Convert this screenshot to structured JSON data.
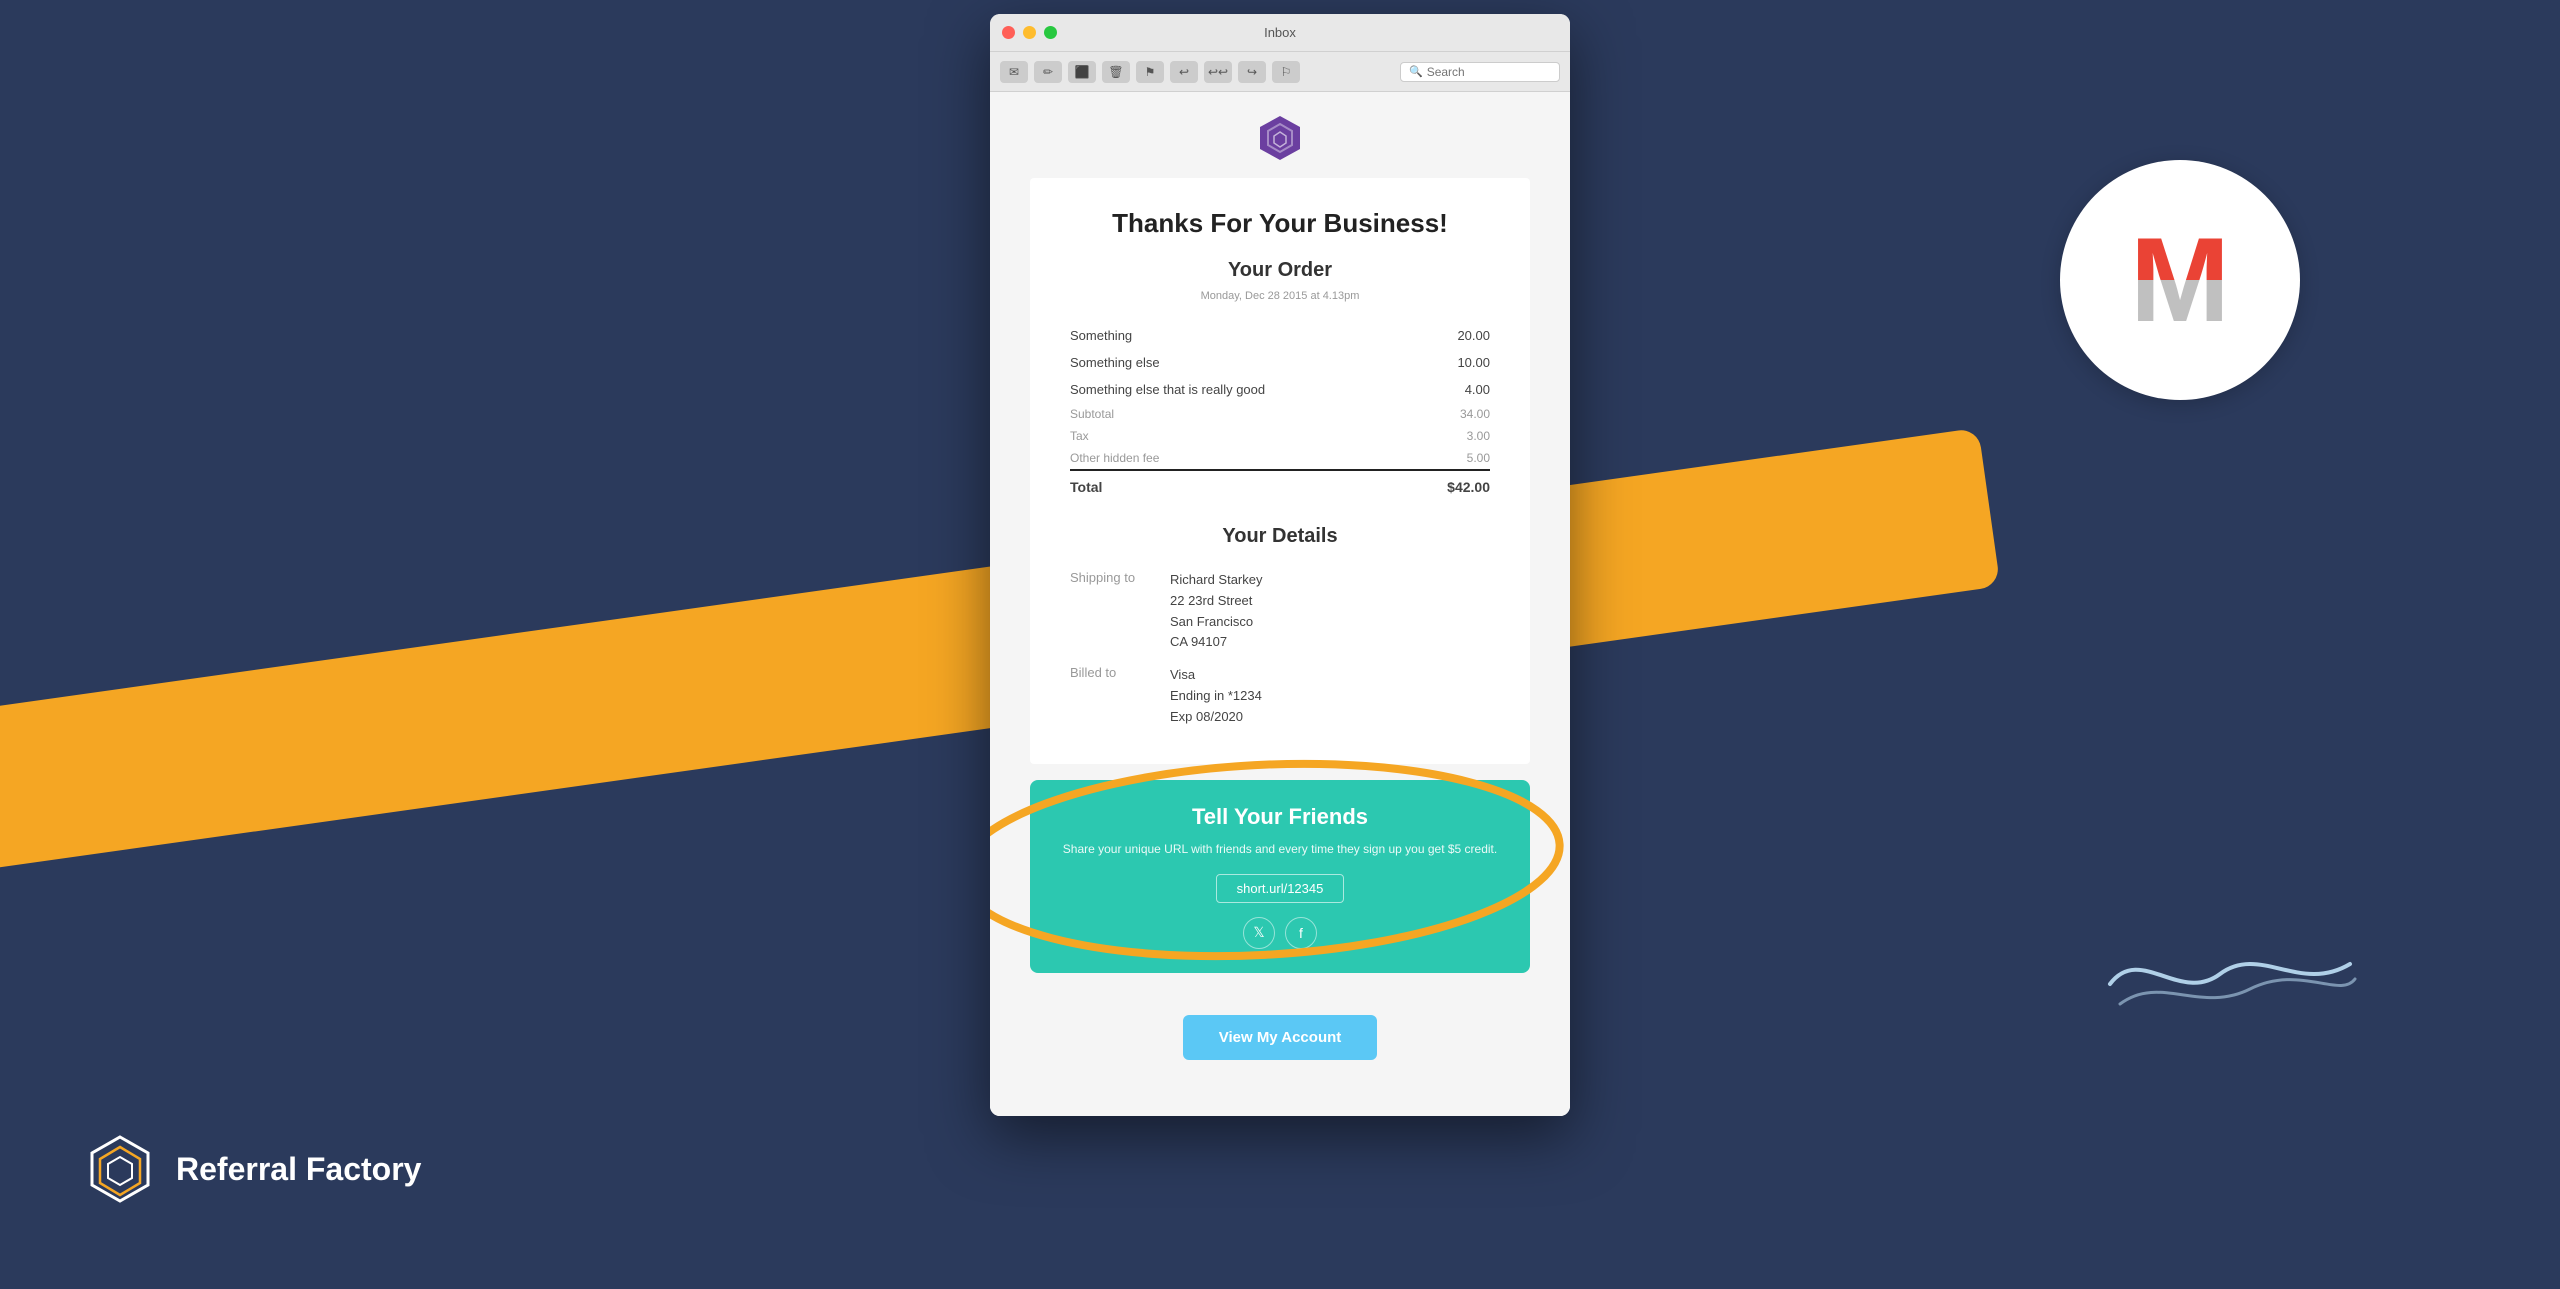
{
  "background": {
    "color": "#2b3a5c"
  },
  "brand": {
    "name": "Referral Factory"
  },
  "mac_window": {
    "title": "Inbox",
    "search_placeholder": "Search"
  },
  "email": {
    "main_title": "Thanks For Your Business!",
    "order_section_title": "Your Order",
    "order_date": "Monday, Dec 28 2015 at 4.13pm",
    "order_items": [
      {
        "name": "Something",
        "price": "20.00"
      },
      {
        "name": "Something else",
        "price": "10.00"
      },
      {
        "name": "Something else that is really good",
        "price": "4.00"
      }
    ],
    "subtotal_label": "Subtotal",
    "subtotal_value": "34.00",
    "tax_label": "Tax",
    "tax_value": "3.00",
    "hidden_fee_label": "Other hidden fee",
    "hidden_fee_value": "5.00",
    "total_label": "Total",
    "total_value": "$42.00",
    "details_section_title": "Your Details",
    "shipping_label": "Shipping to",
    "shipping_name": "Richard Starkey",
    "shipping_address": "22 23rd Street\nSan Francisco\nCA 94107",
    "billing_label": "Billed to",
    "billing_card": "Visa",
    "billing_ending": "Ending in *1234",
    "billing_expiry": "Exp 08/2020",
    "tyfriends_title": "Tell Your Friends",
    "tyfriends_desc": "Share your unique URL with friends and every time they sign up you get $5 credit.",
    "tyfriends_url": "short.url/12345",
    "view_account_label": "View My Account"
  }
}
